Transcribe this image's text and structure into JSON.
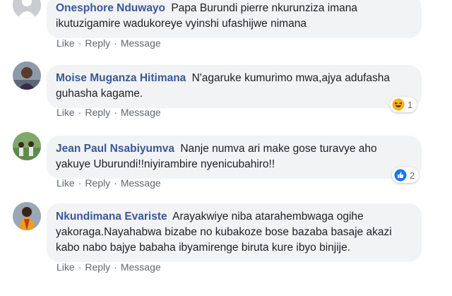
{
  "comments": [
    {
      "author": "Onesphore Nduwayo",
      "text": "Papa Burundi pierre nkurunziza imana ikutuzigamire wadukoreye vyinshi ufashijwe nimana",
      "actions": {
        "like": "Like",
        "reply": "Reply",
        "message": "Message"
      }
    },
    {
      "author": "Moise Muganza Hitimana",
      "text": "N'agaruke kumurimo mwa,ajya adufasha guhasha kagame.",
      "actions": {
        "like": "Like",
        "reply": "Reply",
        "message": "Message"
      },
      "reaction": {
        "icon": "haha-emoji-icon",
        "count": "1"
      }
    },
    {
      "author": "Jean Paul Nsabiyumva",
      "text": "Nanje numva ari make gose turavye aho yakuye Uburundi!!niyirambire nyenicubahiro!!",
      "actions": {
        "like": "Like",
        "reply": "Reply",
        "message": "Message"
      },
      "reaction": {
        "icon": "like-thumb-icon",
        "count": "2"
      }
    },
    {
      "author": "Nkundimana Evariste",
      "text": "Arayakwiye niba atarahembwaga ogihe yakoraga.Nayahabwa bizabe no kubakoze bose bazaba basaje akazi kabo nabo bajye babaha ibyamirenge biruta kure ibyo binjije.",
      "actions": {
        "like": "Like",
        "reply": "Reply",
        "message": "Message"
      }
    }
  ],
  "colors": {
    "author": "#385898",
    "bubble_bg": "#f2f3f5",
    "action_text": "#606770",
    "like_blue": "#1877f2",
    "haha_yellow": "#f7b125"
  }
}
